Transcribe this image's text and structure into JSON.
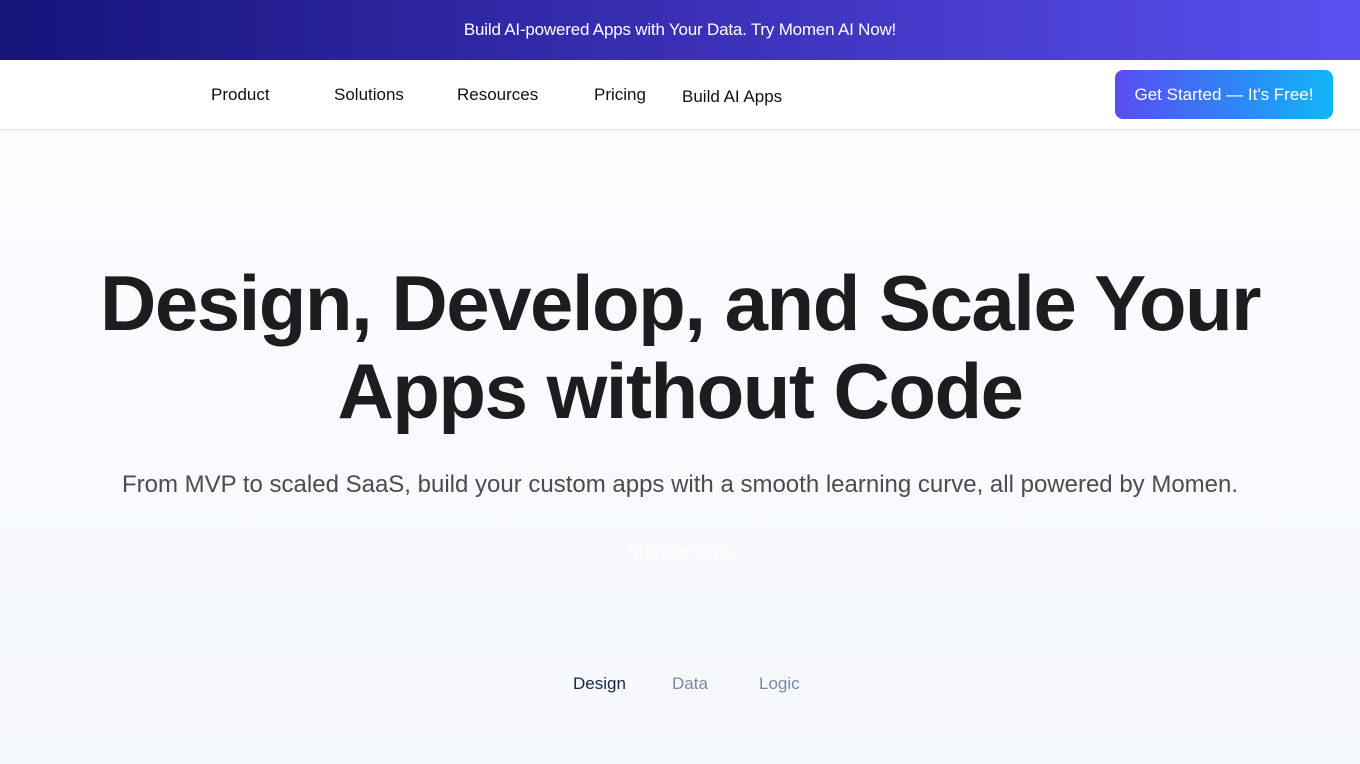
{
  "banner": {
    "text": "Build AI-powered Apps with Your Data. Try Momen AI Now!"
  },
  "nav": {
    "items": [
      {
        "label": "Product"
      },
      {
        "label": "Solutions"
      },
      {
        "label": "Resources"
      },
      {
        "label": "Pricing"
      },
      {
        "label": "Build AI Apps"
      }
    ],
    "cta_label": "Get Started — It's Free!"
  },
  "hero": {
    "title": "Design, Develop, and Scale Your Apps without Code",
    "subtitle": "From MVP to scaled SaaS, build your custom apps with a smooth learning curve, all powered by Momen.",
    "start_label": "Start for Free"
  },
  "tabs": [
    {
      "label": "Design",
      "active": true
    },
    {
      "label": "Data",
      "active": false
    },
    {
      "label": "Logic",
      "active": false
    }
  ],
  "colors": {
    "banner_start": "#16137a",
    "banner_end": "#5b4ff0",
    "cta_start": "#5a4cf2",
    "cta_end": "#13b6f7",
    "tab_active": "#172545",
    "tab_inactive": "#7b8aa4"
  }
}
